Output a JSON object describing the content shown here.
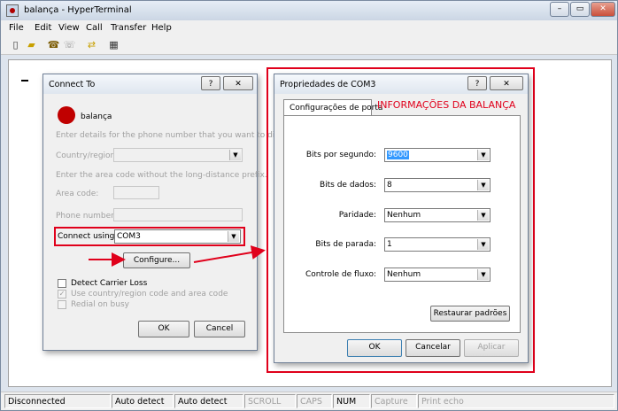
{
  "window": {
    "title": "balança - HyperTerminal",
    "caption_buttons": [
      "–",
      "▭",
      "✕"
    ]
  },
  "menu": [
    "File",
    "Edit",
    "View",
    "Call",
    "Transfer",
    "Help"
  ],
  "toolbar_icons": [
    "new-icon",
    "open-icon",
    "connect-icon",
    "disconnect-icon",
    "send-icon",
    "properties-icon"
  ],
  "statusbar": {
    "items": [
      "Disconnected",
      "Auto detect",
      "Auto detect",
      "SCROLL",
      "CAPS",
      "NUM",
      "Capture",
      "Print echo"
    ]
  },
  "connect": {
    "title": "Connect To",
    "help": "?",
    "close": "✕",
    "connection_name": "balança",
    "enter_details": "Enter details for the phone number that you want to dial:",
    "country_label": "Country/region:",
    "area_prefix_note": "Enter the area code without the long-distance prefix.",
    "area_code_label": "Area code:",
    "phone_label": "Phone number:",
    "connect_using_label": "Connect using:",
    "connect_using_value": "COM3",
    "configure_button": "Configure...",
    "detect_carrier": "Detect Carrier Loss",
    "use_country": "Use country/region code and area code",
    "redial": "Redial on busy",
    "ok": "OK",
    "cancel": "Cancel"
  },
  "props": {
    "title": "Propriedades de COM3",
    "help": "?",
    "close": "✕",
    "tab_active": "Configurações de porta",
    "tab_annotation": "INFORMAÇÕES DA BALANÇA",
    "bits_per_second_label": "Bits por segundo:",
    "bits_per_second_value": "9600",
    "data_bits_label": "Bits de dados:",
    "data_bits_value": "8",
    "parity_label": "Paridade:",
    "parity_value": "Nenhum",
    "stop_bits_label": "Bits de parada:",
    "stop_bits_value": "1",
    "flow_label": "Controle de fluxo:",
    "flow_value": "Nenhum",
    "restore_button": "Restaurar padrões",
    "ok": "OK",
    "cancel": "Cancelar",
    "apply": "Aplicar"
  },
  "colors": {
    "annotation_red": "#e0001b",
    "selection_blue": "#3399ff"
  }
}
